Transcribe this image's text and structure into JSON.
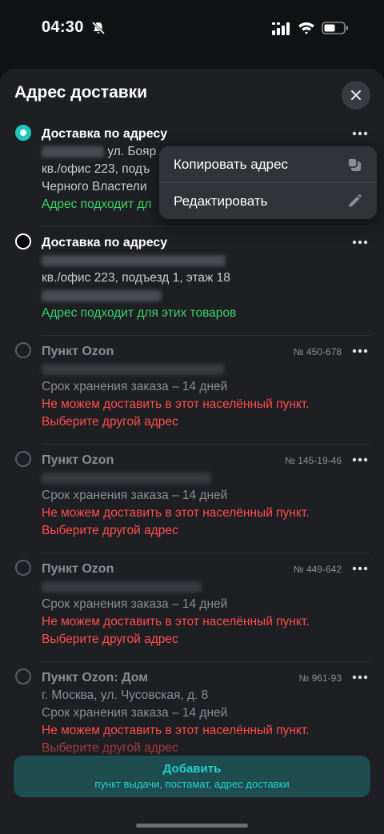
{
  "status_bar": {
    "time": "04:30",
    "icons": [
      "bell-slash-icon",
      "signal-icon",
      "wifi-icon",
      "battery-icon"
    ]
  },
  "sheet": {
    "title": "Адрес доставки",
    "close_icon": "close-icon"
  },
  "addresses": [
    {
      "title": "Доставка по адресу",
      "state": "selected",
      "line1_visible": "ул. Бояр",
      "line2": "кв./офис 223, подъ",
      "line3": "Черного Властели",
      "status": "Адрес подходит дл",
      "status_type": "ok"
    },
    {
      "title": "Доставка по адресу",
      "state": "default",
      "line2": "кв./офис 223, подъезд 1, этаж 18",
      "status": "Адрес подходит для этих товаров",
      "status_type": "ok"
    },
    {
      "title": "Пункт Ozon",
      "code": "№ 450-678",
      "state": "disabled",
      "storage": "Срок хранения заказа – 14 дней",
      "error1": "Не можем доставить в этот населённый пункт.",
      "error2": "Выберите другой адрес"
    },
    {
      "title": "Пункт Ozon",
      "code": "№ 145-19-46",
      "state": "disabled",
      "storage": "Срок хранения заказа – 14 дней",
      "error1": "Не можем доставить в этот населённый пункт.",
      "error2": "Выберите другой адрес"
    },
    {
      "title": "Пункт Ozon",
      "code": "№ 449-642",
      "state": "disabled",
      "storage": "Срок хранения заказа – 14 дней",
      "error1": "Не можем доставить в этот населённый пункт.",
      "error2": "Выберите другой адрес"
    },
    {
      "title": "Пункт Ozon: Дом",
      "code": "№ 961-93",
      "state": "disabled",
      "address": "г. Москва, ул. Чусовская, д. 8",
      "storage": "Срок хранения заказа – 14 дней",
      "error1": "Не можем доставить в этот населённый пункт.",
      "error2": "Выберите другой адрес"
    }
  ],
  "context_menu": {
    "copy_label": "Копировать адрес",
    "copy_icon": "copy-icon",
    "edit_label": "Редактировать",
    "edit_icon": "pencil-icon"
  },
  "add_button": {
    "title": "Добавить",
    "subtitle": "пункт выдачи, постамат, адрес доставки"
  },
  "colors": {
    "accent": "#22d3cb",
    "ok": "#3dd36a",
    "error": "#ff4d4d",
    "sheet_bg": "#1e1f23"
  }
}
